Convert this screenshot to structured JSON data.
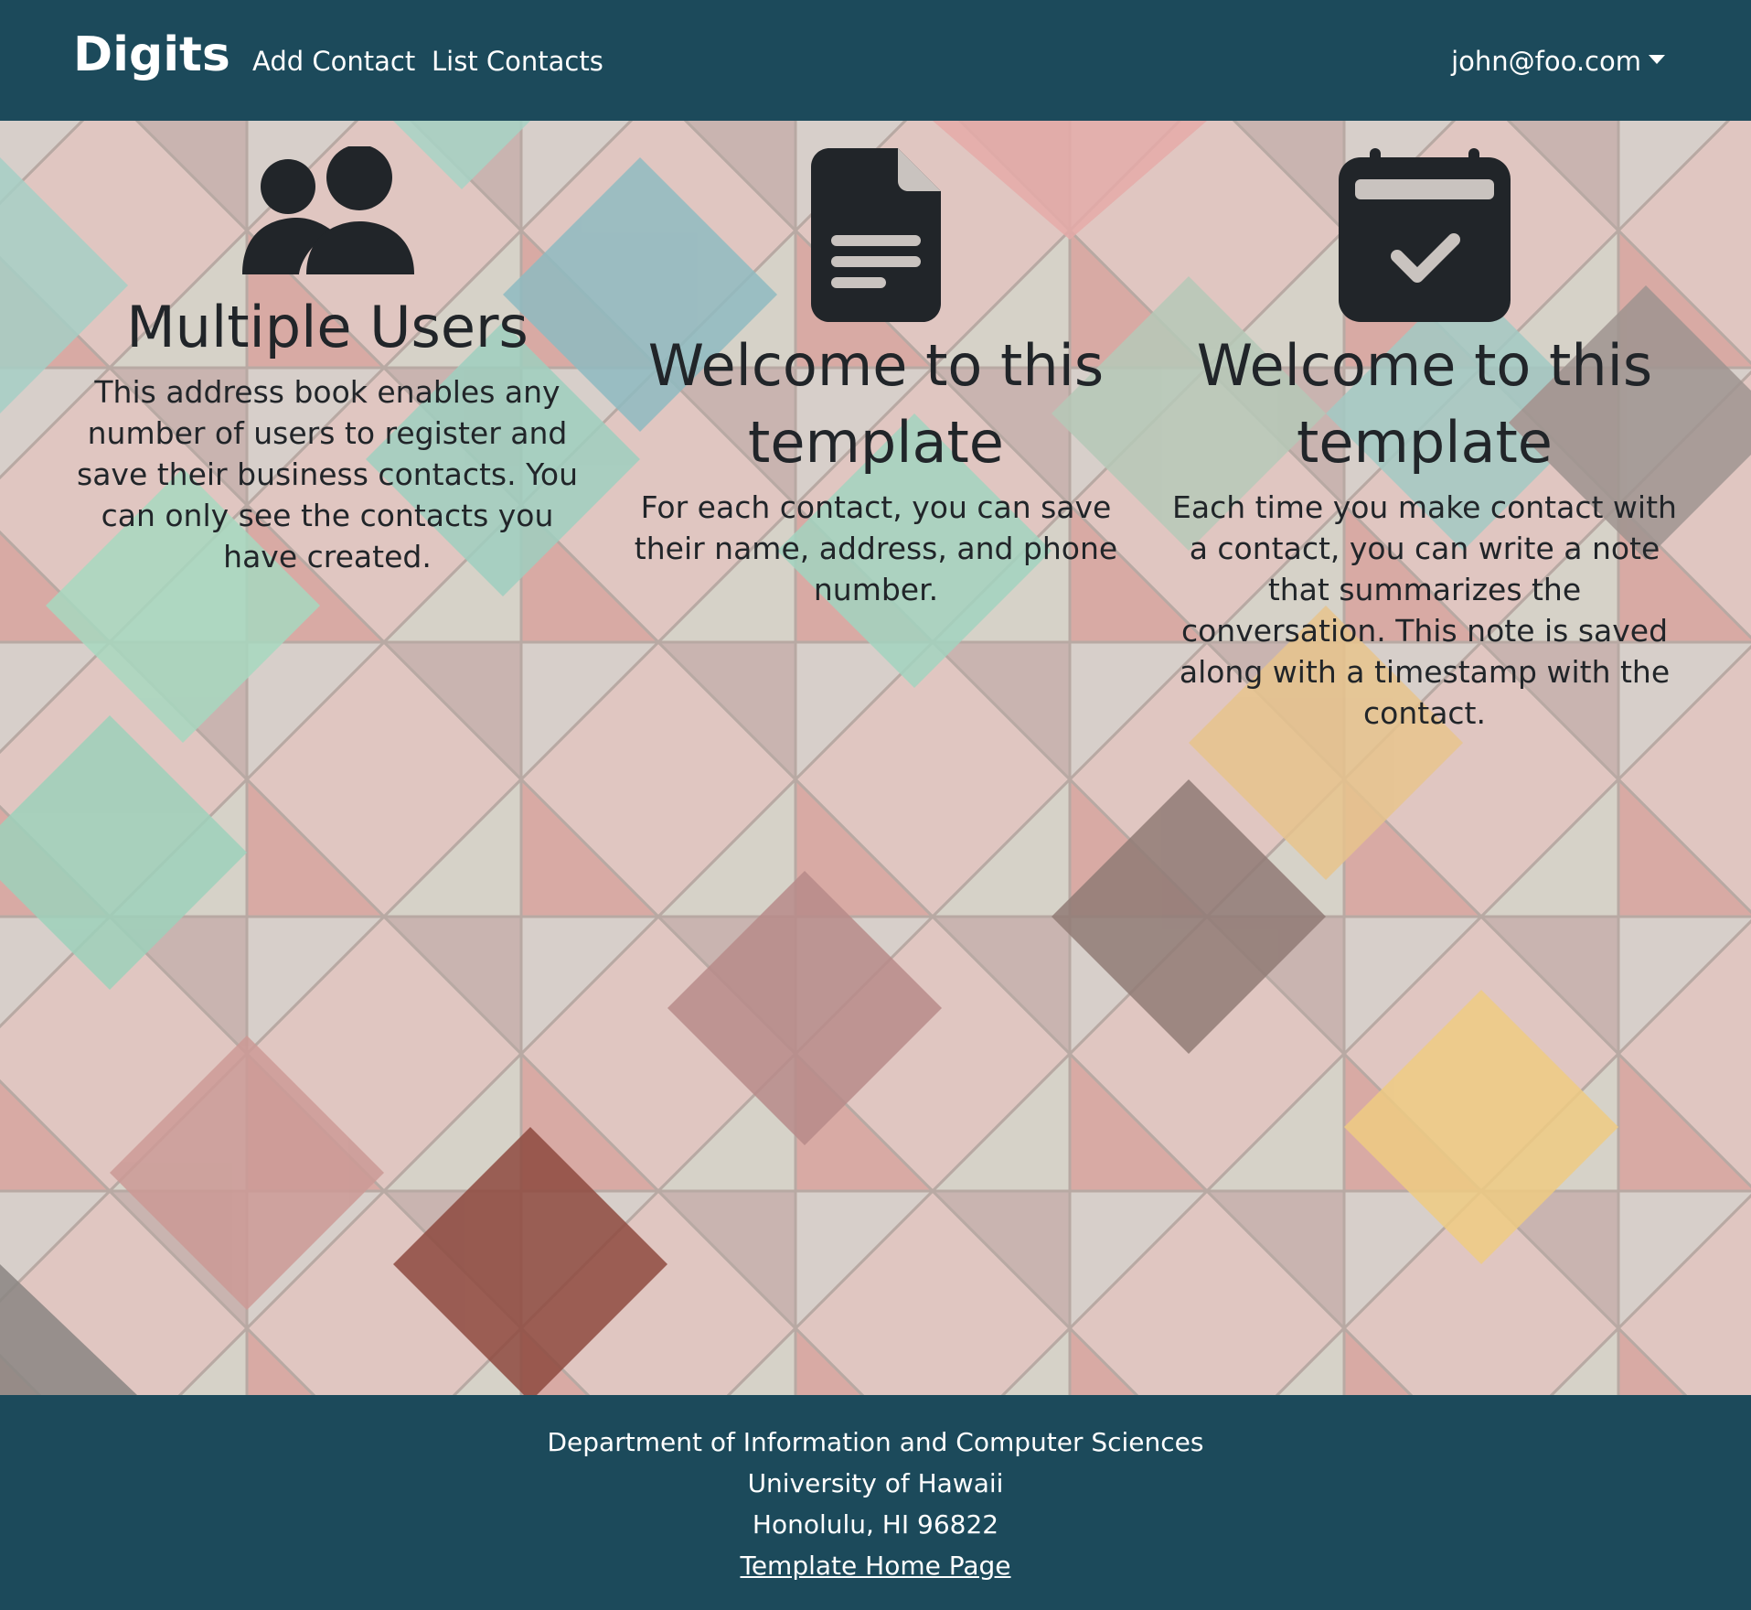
{
  "navbar": {
    "brand": "Digits",
    "links": [
      "Add Contact",
      "List Contacts"
    ],
    "user": "john@foo.com",
    "user_menu_icon": "caret-down-icon",
    "background": "#1c4a5b"
  },
  "features": [
    {
      "icon": "users-icon",
      "title": "Multiple Users",
      "text": "This address book enables any number of users to register and save their business contacts. You can only see the contacts you have created."
    },
    {
      "icon": "file-text-icon",
      "title": "Welcome to this template",
      "text": "For each contact, you can save their name, address, and phone number."
    },
    {
      "icon": "calendar-check-icon",
      "title": "Welcome to this template",
      "text": "Each time you make contact with a contact, you can write a note that summarizes the conversation. This note is saved along with a timestamp with the contact."
    }
  ],
  "footer": {
    "lines": [
      "Department of Information and Computer Sciences",
      "University of Hawaii",
      "Honolulu, HI 96822"
    ],
    "link": "Template Home Page"
  },
  "colors": {
    "nav_footer": "#1c4a5b",
    "text_dark": "#212529"
  }
}
